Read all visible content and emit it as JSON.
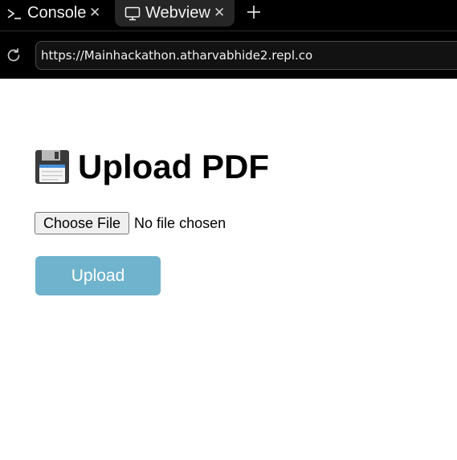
{
  "tabs": [
    {
      "label": "Console",
      "icon": "terminal-prompt-icon",
      "active": false
    },
    {
      "label": "Webview",
      "icon": "monitor-icon",
      "active": true
    }
  ],
  "new_tab_icon": "plus-icon",
  "address_bar": {
    "url": "https://Mainhackathon.atharvabhide2.repl.co",
    "reload_icon": "reload-icon"
  },
  "page": {
    "heading_emoji_icon": "floppy-disk-icon",
    "heading": "Upload PDF",
    "file_input": {
      "button_label": "Choose File",
      "status": "No file chosen"
    },
    "upload_button_label": "Upload",
    "upload_button_color": "#6fb3cd"
  }
}
